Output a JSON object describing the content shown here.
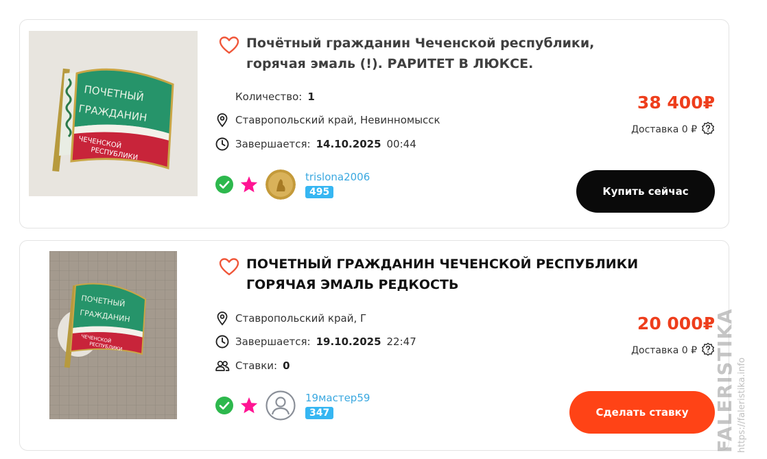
{
  "listings": [
    {
      "title": "Почётный гражданин Чеченской республики, горячая эмаль (!). РАРИТЕТ В ЛЮКСЕ.",
      "quantity_label": "Количество:",
      "quantity_value": "1",
      "location": "Ставропольский край, Невинномысск",
      "ends_label": "Завершается:",
      "ends_date": "14.10.2025",
      "ends_time": "00:44",
      "price": "38 400₽",
      "delivery": "Доставка 0 ₽",
      "seller_name": "trislona2006",
      "seller_rating": "495",
      "action_label": "Купить сейчас",
      "photo_text": [
        "ПОЧЕТНЫЙ",
        "ГРАЖДАНИН",
        "ЧЕЧЕНСКОЙ",
        "РЕСПУБЛИКИ"
      ]
    },
    {
      "title": "ПОЧЕТНЫЙ ГРАЖДАНИН ЧЕЧЕНСКОЙ РЕСПУБЛИКИ ГОРЯЧАЯ ЭМАЛЬ РЕДКОСТЬ",
      "location": "Ставропольский край, Г",
      "ends_label": "Завершается:",
      "ends_date": "19.10.2025",
      "ends_time": "22:47",
      "bids_label": "Ставки:",
      "bids_value": "0",
      "price": "20 000₽",
      "delivery": "Доставка 0 ₽",
      "seller_name": "19мастер59",
      "seller_rating": "347",
      "action_label": "Сделать ставку",
      "photo_text": [
        "ПОЧЕТНЫЙ",
        "ГРАЖДАНИН",
        "ЧЕЧЕНСКОЙ",
        "РЕСПУБЛИКИ"
      ]
    }
  ],
  "watermark": {
    "main": "FALERISTIKA.INFO",
    "sub": "https://faleristika.info"
  },
  "colors": {
    "price": "#ee3e1c",
    "buy_button": "#0a0a0a",
    "bid_button": "#ff4316",
    "rating_badge": "#36b6f2",
    "seller_link": "#3aa8e0",
    "verified": "#2db84d",
    "star": "#ff1493",
    "favorite": "#f0573a"
  },
  "icons": [
    "heart-icon",
    "location-pin-icon",
    "clock-icon",
    "bids-icon",
    "help-icon",
    "verified-icon",
    "star-icon",
    "avatar-icon"
  ]
}
